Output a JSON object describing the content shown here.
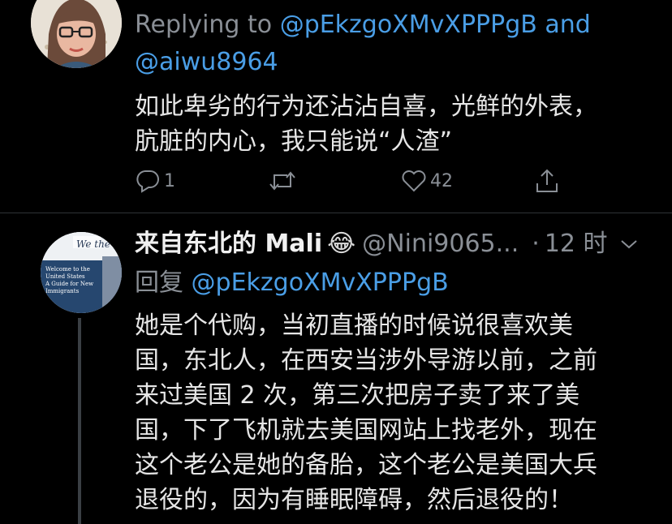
{
  "tweet1": {
    "reply_prefix": "Replying to",
    "reply_to_1": "@pEkzgoXMvXPPPgB",
    "reply_and": "and",
    "reply_to_2": "@aiwu8964",
    "text_lines": [
      "如此卑劣的行为还沾沾自喜，光鲜的外表，",
      "肮脏的内心，我只能说“人渣”"
    ],
    "actions": {
      "reply_count": "1",
      "retweet_count": "",
      "like_count": "42"
    }
  },
  "tweet2": {
    "display_name": "来自东北的 Mali",
    "emoji": "😂",
    "handle": "@Nini9065...",
    "separator": "·",
    "time": "12 时",
    "reply_prefix": "回复",
    "reply_to": "@pEkzgoXMvXPPPgB",
    "text_lines": [
      "她是个代购，当初直播的时候说很喜欢美",
      "国，东北人，在西安当涉外导游以前，之前",
      "来过美国 2 次，第三次把房子卖了来了美",
      "国，下了飞机就去美国网站上找老外，现在",
      "这个老公是她的备胎，这个老公是美国大兵",
      "退役的，因为有睡眠障碍，然后退役的！"
    ]
  },
  "avatar2_sign": {
    "title": "We the",
    "line1": "Welcome to the",
    "line2": "United States",
    "line3": "A Guide for New",
    "line4": "Immigrants"
  },
  "colors": {
    "background": "#000000",
    "link": "#4a9ee6",
    "muted": "#8a8f96",
    "text": "#e6e6e6"
  }
}
